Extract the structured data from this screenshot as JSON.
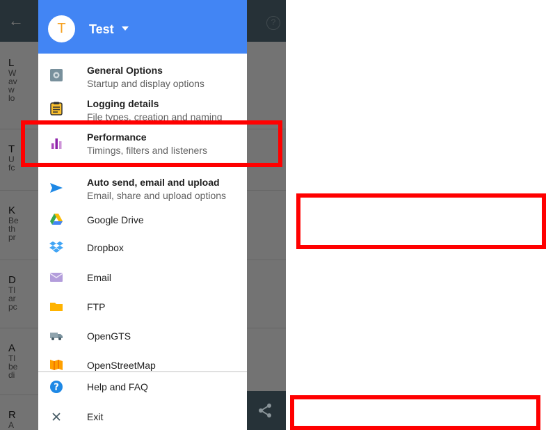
{
  "drawer": {
    "account_initial": "T",
    "account_name": "Test",
    "items": [
      {
        "title": "General Options",
        "subtitle": "Startup and display options",
        "icon": "gear-icon"
      },
      {
        "title": "Logging details",
        "subtitle": "File types, creation and naming",
        "icon": "clipboard-icon"
      },
      {
        "title": "Performance",
        "subtitle": "Timings, filters and listeners",
        "icon": "bar-chart-icon"
      },
      {
        "title": "Auto send, email and upload",
        "subtitle": "Email, share and upload options",
        "icon": "send-icon"
      },
      {
        "title": "Google Drive",
        "icon": "google-drive-icon"
      },
      {
        "title": "Dropbox",
        "icon": "dropbox-icon"
      },
      {
        "title": "Email",
        "icon": "email-icon"
      },
      {
        "title": "FTP",
        "icon": "folder-icon"
      },
      {
        "title": "OpenGTS",
        "icon": "truck-icon"
      },
      {
        "title": "OpenStreetMap",
        "icon": "map-icon"
      },
      {
        "title": "Help and FAQ",
        "icon": "help-icon"
      },
      {
        "title": "Exit",
        "icon": "close-icon"
      }
    ]
  },
  "background": {
    "items": [
      {
        "title": "L",
        "lines": [
          "W",
          "av",
          "w",
          "lo"
        ]
      },
      {
        "title": "T",
        "lines": [
          "U",
          "fc"
        ]
      },
      {
        "title": "K",
        "lines": [
          "Be",
          "th",
          "pr"
        ]
      },
      {
        "title": "D",
        "lines": [
          "Tl",
          "ar",
          "pc"
        ]
      },
      {
        "title": "A",
        "lines": [
          "Tl",
          "be",
          "di"
        ]
      },
      {
        "title": "R",
        "lines": [
          "A"
        ]
      }
    ]
  },
  "colors": {
    "header": "#4285f4",
    "annotation": "#ff0000",
    "app_bar": "#546e7a"
  }
}
